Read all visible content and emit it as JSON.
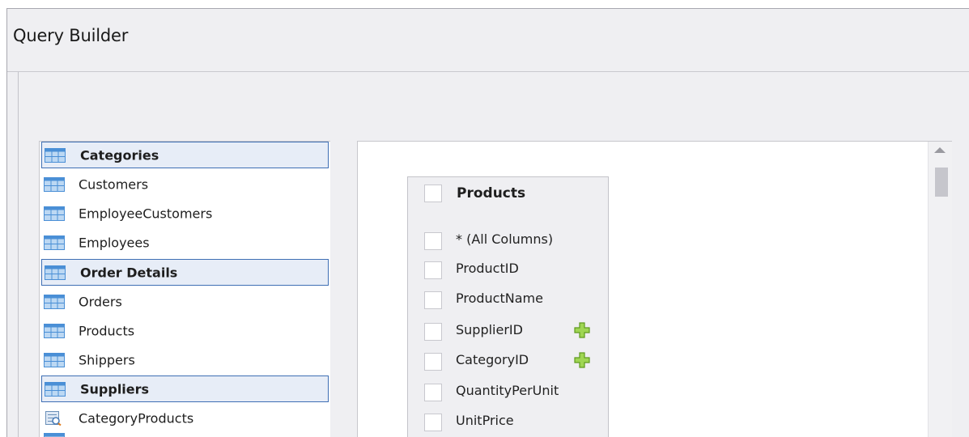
{
  "window": {
    "title": "Query Builder"
  },
  "tables_list": {
    "items": [
      {
        "label": "Categories",
        "selected": true,
        "icon": "table-icon"
      },
      {
        "label": "Customers",
        "selected": false,
        "icon": "table-icon"
      },
      {
        "label": "EmployeeCustomers",
        "selected": false,
        "icon": "table-icon"
      },
      {
        "label": "Employees",
        "selected": false,
        "icon": "table-icon"
      },
      {
        "label": "Order Details",
        "selected": true,
        "icon": "table-icon"
      },
      {
        "label": "Orders",
        "selected": false,
        "icon": "table-icon"
      },
      {
        "label": "Products",
        "selected": false,
        "icon": "table-icon"
      },
      {
        "label": "Shippers",
        "selected": false,
        "icon": "table-icon"
      },
      {
        "label": "Suppliers",
        "selected": true,
        "icon": "table-icon"
      },
      {
        "label": "CategoryProducts",
        "selected": false,
        "icon": "view-icon"
      }
    ]
  },
  "design_surface": {
    "table_card": {
      "title": "Products",
      "columns": [
        {
          "label": "* (All Columns)",
          "has_add": false
        },
        {
          "label": "ProductID",
          "has_add": false
        },
        {
          "label": "ProductName",
          "has_add": false
        },
        {
          "label": "SupplierID",
          "has_add": true
        },
        {
          "label": "CategoryID",
          "has_add": true
        },
        {
          "label": "QuantityPerUnit",
          "has_add": false
        },
        {
          "label": "UnitPrice",
          "has_add": false
        }
      ]
    }
  },
  "colors": {
    "window_bg": "#efeff2",
    "selection_border": "#3f6fb4",
    "selection_bg": "#e7edf7",
    "table_icon_blue": "#4a8fd6",
    "add_icon_green": "#7dbb2a"
  }
}
